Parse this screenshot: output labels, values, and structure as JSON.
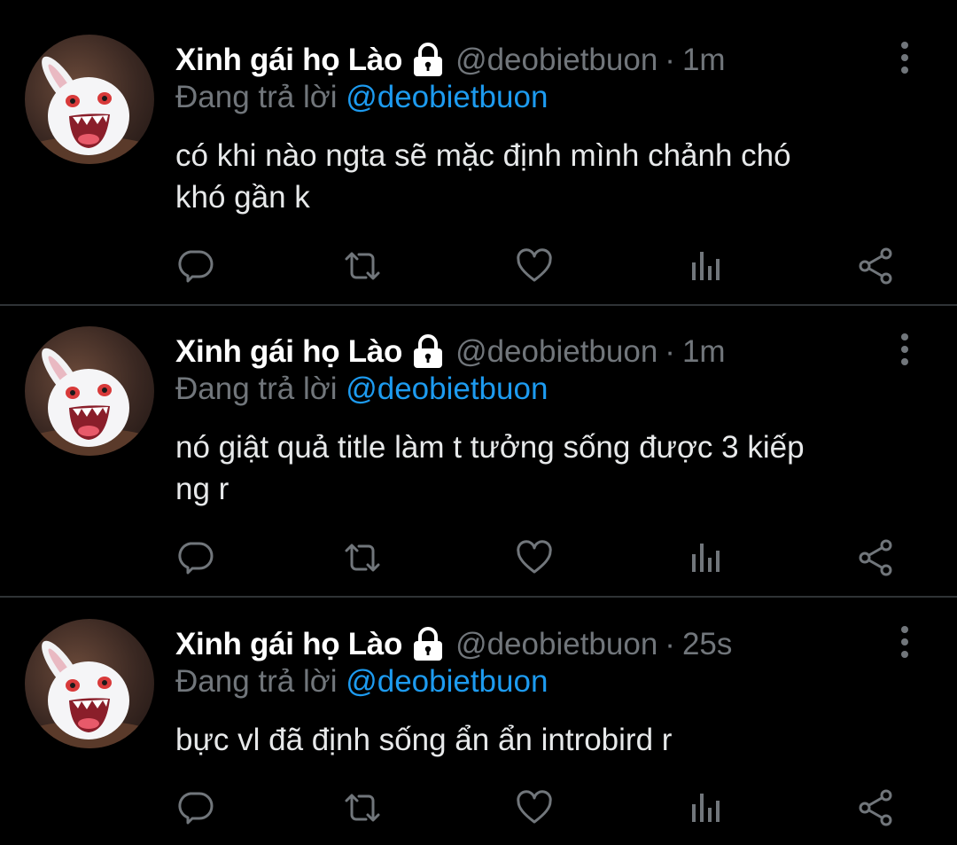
{
  "tweets": [
    {
      "name": "Xinh gái họ Lào",
      "handle": "@deobietbuon",
      "separator": "·",
      "time": "1m",
      "replying_prefix": "Đang trả lời",
      "replying_to": "@deobietbuon",
      "text": "có khi nào ngta sẽ mặc định mình chảnh chó\nkhó gần k"
    },
    {
      "name": "Xinh gái họ Lào",
      "handle": "@deobietbuon",
      "separator": "·",
      "time": "1m",
      "replying_prefix": "Đang trả lời",
      "replying_to": "@deobietbuon",
      "text": "nó giật quả title làm t tưởng sống được 3 kiếp\nng r"
    },
    {
      "name": "Xinh gái họ Lào",
      "handle": "@deobietbuon",
      "separator": "·",
      "time": "25s",
      "replying_prefix": "Đang trả lời",
      "replying_to": "@deobietbuon",
      "text": "bực vl đã định sống ẩn ẩn introbird r"
    }
  ],
  "icons": {
    "protected": "lock-icon",
    "more": "more-vertical-icon",
    "reply": "reply-icon",
    "retweet": "retweet-icon",
    "like": "heart-icon",
    "views": "views-icon",
    "share": "share-icon"
  },
  "colors": {
    "background": "#000000",
    "text": "#e7e9ea",
    "secondary": "#71767b",
    "mention": "#1d9bf0",
    "divider": "#2f3336"
  }
}
